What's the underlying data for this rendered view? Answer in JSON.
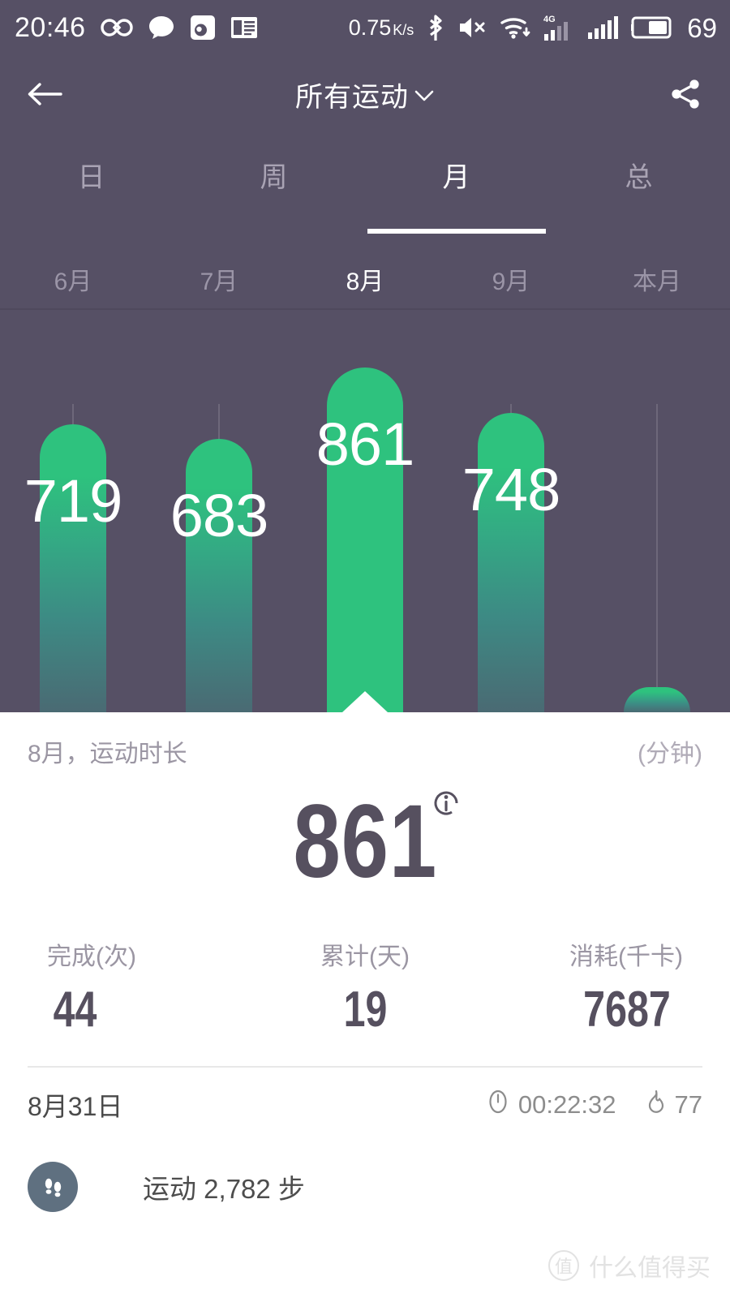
{
  "status_bar": {
    "time": "20:46",
    "net_speed": "0.75",
    "net_speed_unit": "K/s",
    "battery_percent": "69",
    "mobile_network": "4G",
    "icons": [
      "infinity-icon",
      "chat-bubble-icon",
      "weibo-icon",
      "book-icon",
      "bluetooth-icon",
      "volume-mute-icon",
      "wifi-icon",
      "signal-4g-icon",
      "signal-icon",
      "battery-icon"
    ]
  },
  "appbar": {
    "back_label": "back-arrow",
    "title": "所有运动",
    "chevron": "⌄",
    "share_label": "share"
  },
  "tabs": [
    {
      "label": "日",
      "active": false
    },
    {
      "label": "周",
      "active": false
    },
    {
      "label": "月",
      "active": true
    },
    {
      "label": "总",
      "active": false
    }
  ],
  "chart_data": {
    "type": "bar",
    "title": "所有运动 - 月",
    "xlabel": "",
    "ylabel": "分钟",
    "unit": "分钟",
    "categories": [
      "6月",
      "7月",
      "8月",
      "9月",
      "本月"
    ],
    "values": [
      719,
      683,
      861,
      748,
      62
    ],
    "value_labels": [
      "719",
      "683",
      "861",
      "748",
      ""
    ],
    "selected_index": 2,
    "grid": true,
    "legend": "none",
    "ylim": [
      0,
      900
    ],
    "bar_color": "#2ec27e",
    "bar_gradient_end": "#4a6a73",
    "background": "#565065"
  },
  "summary": {
    "period_label": "8月，运动时长",
    "unit_label": "(分钟)",
    "value": "861",
    "info_icon": "info-icon"
  },
  "stats": [
    {
      "key": "完成(次)",
      "value": "44"
    },
    {
      "key": "累计(天)",
      "value": "19"
    },
    {
      "key": "消耗(千卡)",
      "value": "7687"
    }
  ],
  "day_entry": {
    "date": "8月31日",
    "duration_icon": "clock-icon",
    "duration": "00:22:32",
    "calories_icon": "flame-icon",
    "calories": "77"
  },
  "activity": {
    "icon": "footprints-icon",
    "text": "运动 2,782 步"
  },
  "watermark": {
    "badge": "值",
    "text": "什么值得买"
  },
  "colors": {
    "dark_bg": "#565065",
    "accent_green": "#2ec27e",
    "text_dark": "#56505f",
    "text_muted": "#9b96a3"
  }
}
